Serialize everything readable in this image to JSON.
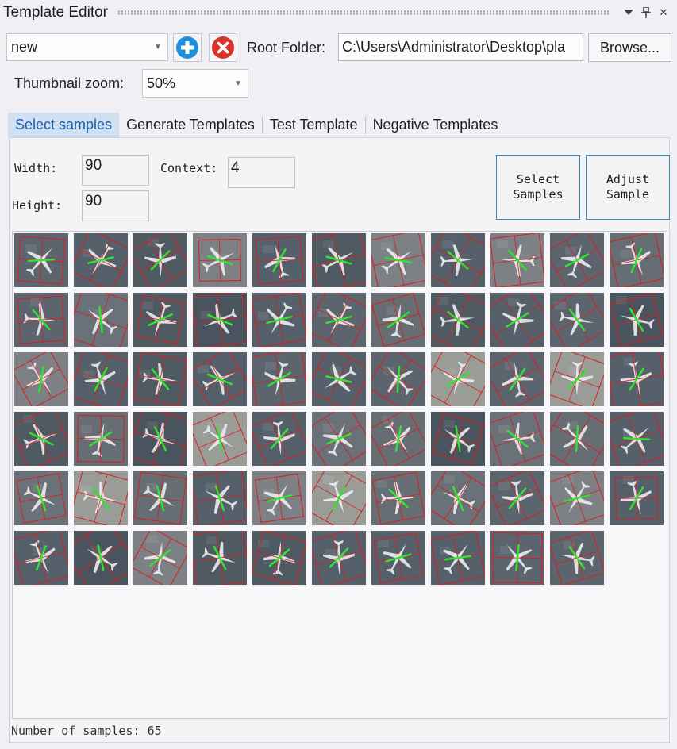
{
  "window": {
    "title": "Template Editor",
    "pin_icon": "pin-icon",
    "close_label": "✕"
  },
  "toolbar": {
    "template_value": "new",
    "add_icon": "plus-circle-icon",
    "delete_icon": "x-circle-icon",
    "root_folder_label": "Root Folder:",
    "root_folder_value": "C:\\Users\\Administrator\\Desktop\\pla",
    "browse_label": "Browse...",
    "zoom_label": "Thumbnail zoom:",
    "zoom_value": "50%"
  },
  "tabs": [
    {
      "label": "Select samples",
      "active": true
    },
    {
      "label": "Generate Templates",
      "active": false
    },
    {
      "label": "Test Template",
      "active": false
    },
    {
      "label": "Negative Templates",
      "active": false
    }
  ],
  "params": {
    "width_label": "Width:",
    "width_value": "90",
    "height_label": "Height:",
    "height_value": "90",
    "context_label": "Context:",
    "context_value": "4"
  },
  "buttons": {
    "select_samples": "Select\nSamples",
    "adjust_sample": "Adjust\nSample"
  },
  "samples": {
    "count": 65
  },
  "status": {
    "text": "Number of samples: 65"
  },
  "colors": {
    "accent_tab_bg": "#cfe0f3",
    "accent_tab_text": "#1a5ea8",
    "add_icon": "#1e8fdc",
    "delete_icon": "#d9342b",
    "box_outline": "#e01a1a",
    "axis_line": "#2ee62e"
  }
}
